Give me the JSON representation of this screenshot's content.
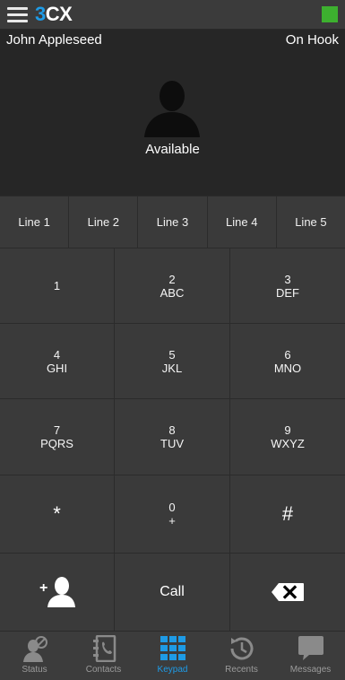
{
  "header": {
    "logo_num": "3",
    "logo_cx": "CX",
    "status_color": "#3db02f"
  },
  "profile": {
    "name": "John Appleseed",
    "hook_status": "On Hook",
    "presence": "Available"
  },
  "lines": [
    "Line 1",
    "Line 2",
    "Line 3",
    "Line 4",
    "Line 5"
  ],
  "keypad": {
    "k1": {
      "digit": "1",
      "letters": ""
    },
    "k2": {
      "digit": "2",
      "letters": "ABC"
    },
    "k3": {
      "digit": "3",
      "letters": "DEF"
    },
    "k4": {
      "digit": "4",
      "letters": "GHI"
    },
    "k5": {
      "digit": "5",
      "letters": "JKL"
    },
    "k6": {
      "digit": "6",
      "letters": "MNO"
    },
    "k7": {
      "digit": "7",
      "letters": "PQRS"
    },
    "k8": {
      "digit": "8",
      "letters": "TUV"
    },
    "k9": {
      "digit": "9",
      "letters": "WXYZ"
    },
    "star": "*",
    "k0": {
      "digit": "0",
      "letters": "+"
    },
    "hash": "#",
    "call": "Call"
  },
  "tabs": {
    "status": "Status",
    "contacts": "Contacts",
    "keypad": "Keypad",
    "recents": "Recents",
    "messages": "Messages"
  },
  "colors": {
    "accent": "#1e9be6",
    "inactive_icon": "#8a8a8a"
  }
}
